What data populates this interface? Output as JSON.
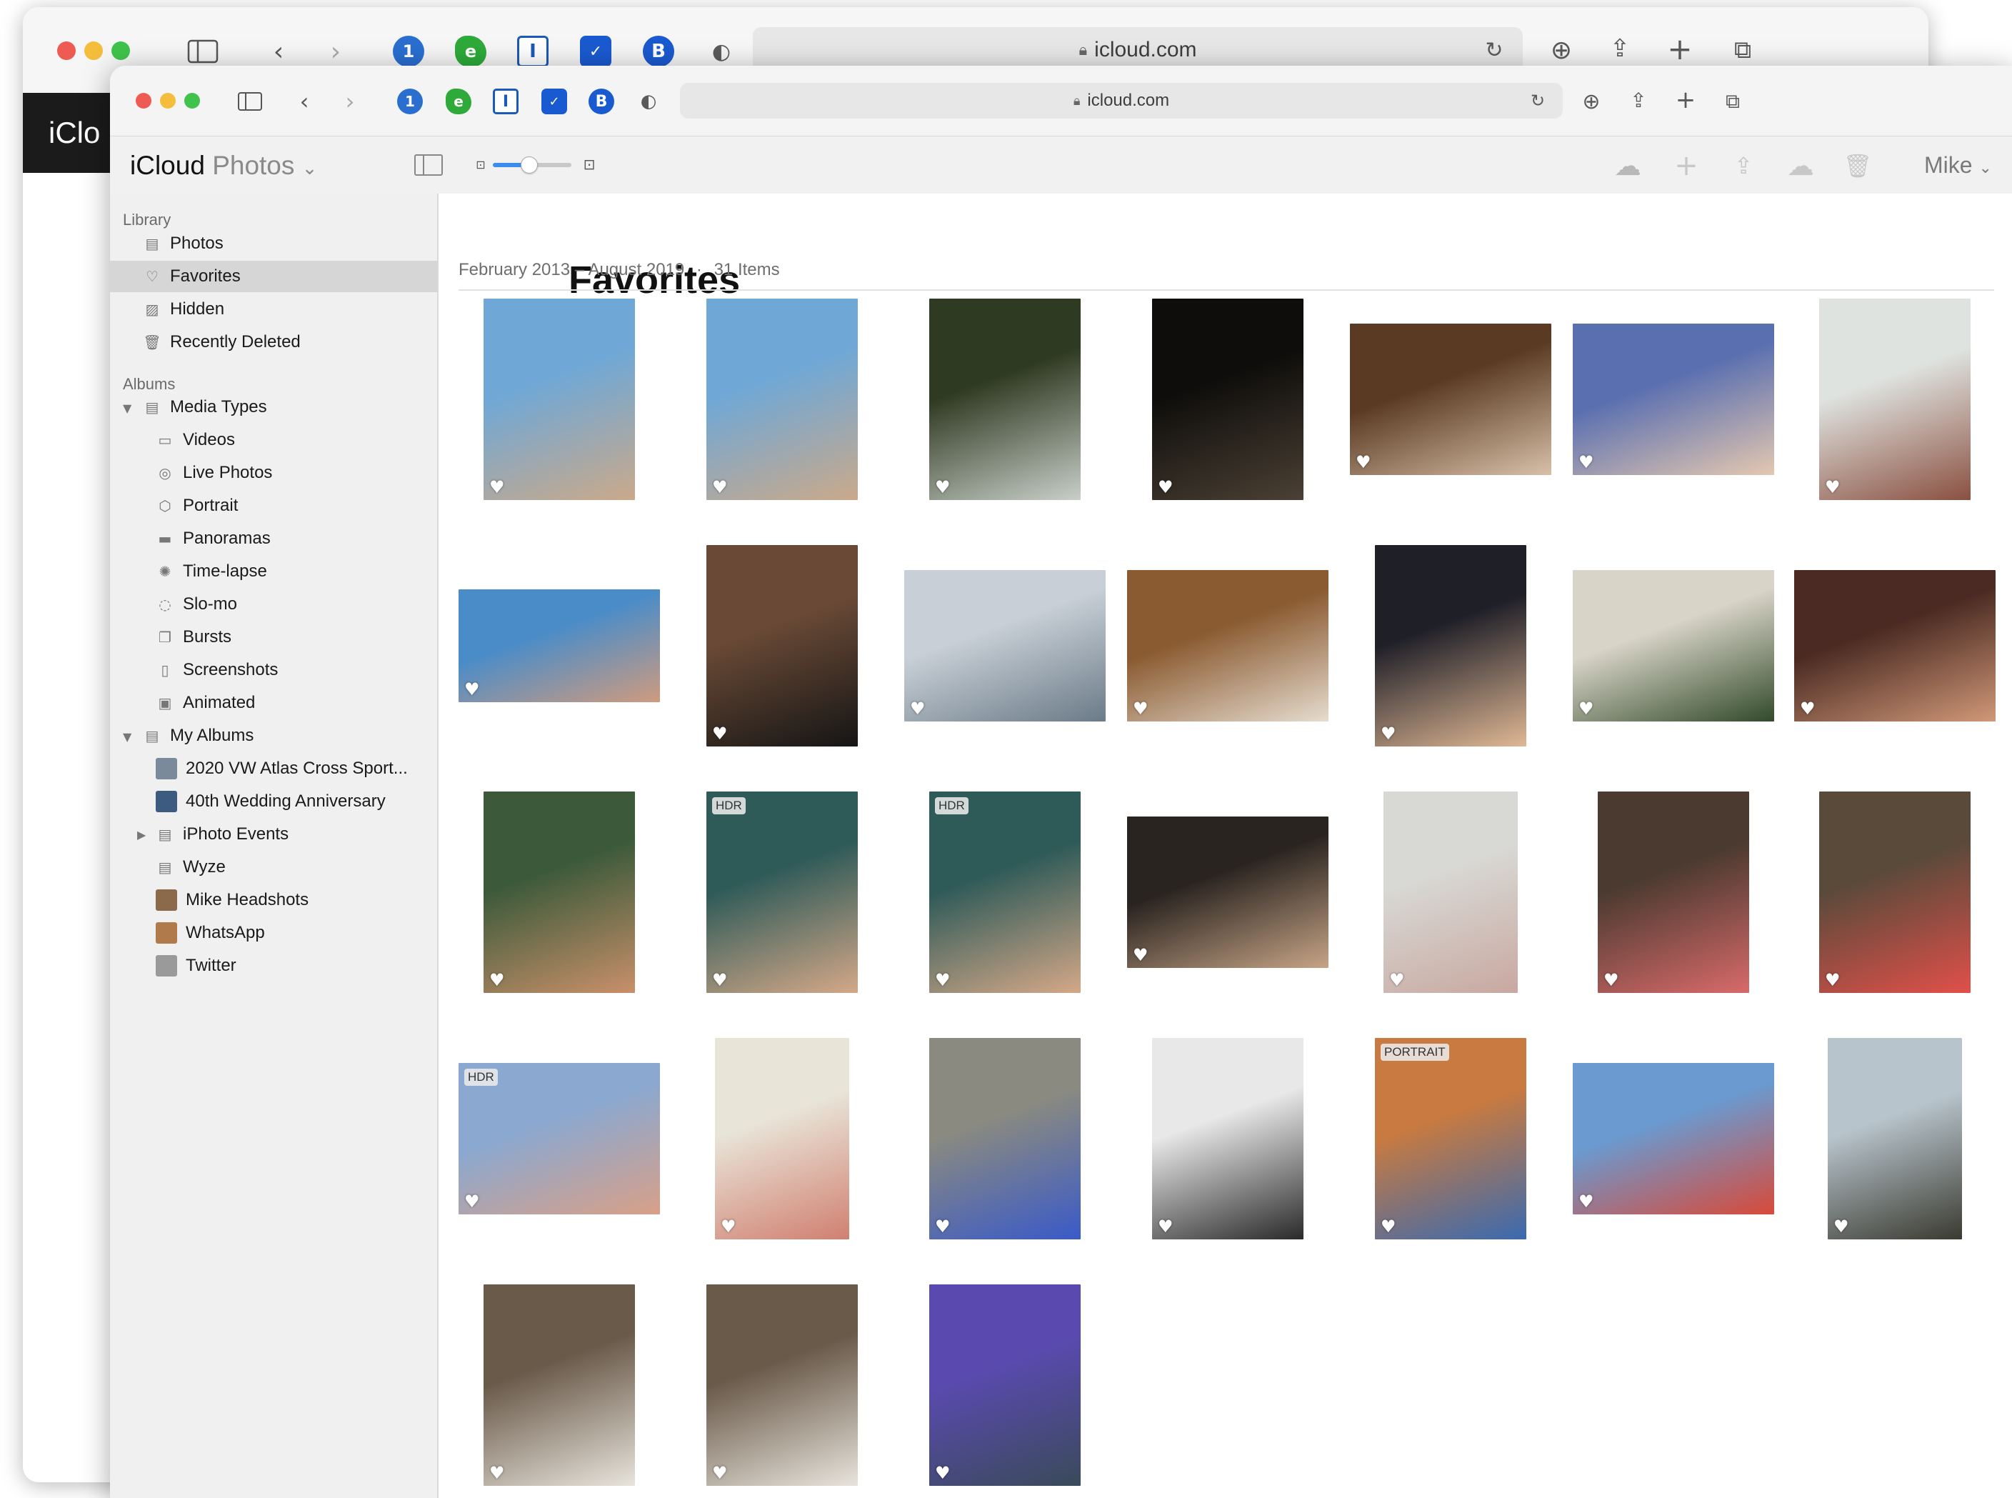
{
  "back_window": {
    "url": "icloud.com",
    "page_peek": "iClo"
  },
  "front_window": {
    "url": "icloud.com"
  },
  "toolbar_icons": [
    "sidebar-toggle-icon",
    "back-icon",
    "forward-icon",
    "onepassword-icon",
    "evernote-icon",
    "instapaper-icon",
    "pocket-icon",
    "bitwarden-icon",
    "privacy-shield-icon",
    "reload-icon",
    "downloads-icon",
    "share-icon",
    "new-tab-icon",
    "tab-overview-icon"
  ],
  "app": {
    "title_brand": "iCloud",
    "title_app": "Photos",
    "title_chevron": "⌄",
    "user_name": "Mike",
    "user_chevron": "⌄",
    "zoom_slider_level": 0.45
  },
  "sidebar": {
    "library_label": "Library",
    "library_items": [
      {
        "label": "Photos",
        "icon": "photos-icon"
      },
      {
        "label": "Favorites",
        "icon": "heart-icon",
        "selected": true
      },
      {
        "label": "Hidden",
        "icon": "hidden-icon"
      },
      {
        "label": "Recently Deleted",
        "icon": "trash-icon"
      }
    ],
    "albums_label": "Albums",
    "media_types_label": "Media Types",
    "media_types": [
      {
        "label": "Videos",
        "icon": "video-icon"
      },
      {
        "label": "Live Photos",
        "icon": "live-photo-icon"
      },
      {
        "label": "Portrait",
        "icon": "portrait-cube-icon"
      },
      {
        "label": "Panoramas",
        "icon": "panorama-icon"
      },
      {
        "label": "Time-lapse",
        "icon": "timelapse-icon"
      },
      {
        "label": "Slo-mo",
        "icon": "slomo-icon"
      },
      {
        "label": "Bursts",
        "icon": "bursts-icon"
      },
      {
        "label": "Screenshots",
        "icon": "screenshot-icon"
      },
      {
        "label": "Animated",
        "icon": "animated-icon"
      }
    ],
    "my_albums_label": "My Albums",
    "my_albums": [
      {
        "label": "2020 VW Atlas Cross Sport...",
        "color": "#7a8a9a"
      },
      {
        "label": "40th Wedding Anniversary",
        "color": "#3d5a80"
      },
      {
        "label": "iPhoto Events",
        "folder": true
      },
      {
        "label": "Wyze",
        "folder": true
      },
      {
        "label": "Mike Headshots",
        "color": "#8a6a4a"
      },
      {
        "label": "WhatsApp",
        "color": "#b07a4a"
      },
      {
        "label": "Twitter",
        "color": "#9a9a9a"
      }
    ]
  },
  "main": {
    "title": "Favorites",
    "date_range": "February 2013 – August 2019",
    "separator": "·",
    "count": "31 Items"
  },
  "photos": [
    {
      "orient": "portrait",
      "c1": "#6fa8d6",
      "c2": "#caa98a"
    },
    {
      "orient": "portrait",
      "c1": "#6fa8d6",
      "c2": "#caa98a"
    },
    {
      "orient": "portrait",
      "c1": "#2f3a22",
      "c2": "#c9cfc9"
    },
    {
      "orient": "portrait",
      "c1": "#0e0d0b",
      "c2": "#4b4034"
    },
    {
      "orient": "landscape",
      "c1": "#5a3a22",
      "c2": "#d8c0a8"
    },
    {
      "orient": "landscape",
      "c1": "#5a6fb0",
      "c2": "#e4c8b0"
    },
    {
      "orient": "portrait",
      "c1": "#dfe3e0",
      "c2": "#8a5040"
    },
    {
      "orient": "wide",
      "c1": "#4a8cc8",
      "c2": "#cf9b7f"
    },
    {
      "orient": "portrait",
      "c1": "#6a4a36",
      "c2": "#151515"
    },
    {
      "orient": "landscape",
      "c1": "#c8cfd6",
      "c2": "#6b7b88"
    },
    {
      "orient": "landscape",
      "c1": "#8a5a30",
      "c2": "#e6dccf"
    },
    {
      "orient": "portrait",
      "c1": "#1f1f28",
      "c2": "#e0b894"
    },
    {
      "orient": "landscape",
      "c1": "#d8d4c8",
      "c2": "#324a2a"
    },
    {
      "orient": "landscape",
      "c1": "#4a2a22",
      "c2": "#d09878"
    },
    {
      "orient": "portrait",
      "c1": "#3c5a3a",
      "c2": "#c8906a"
    },
    {
      "orient": "portrait",
      "c1": "#2e5a58",
      "c2": "#d4a888",
      "badge": "HDR"
    },
    {
      "orient": "portrait",
      "c1": "#2e5a58",
      "c2": "#d4a888",
      "badge": "HDR"
    },
    {
      "orient": "landscape",
      "c1": "#2a2420",
      "c2": "#c6a486"
    },
    {
      "orient": "narrow",
      "c1": "#d8d8d4",
      "c2": "#c8a8a0"
    },
    {
      "orient": "portrait",
      "c1": "#4a3a30",
      "c2": "#d86a6a"
    },
    {
      "orient": "portrait",
      "c1": "#5a4a3a",
      "c2": "#e0504a"
    },
    {
      "orient": "landscape",
      "c1": "#8aa8d0",
      "c2": "#d8a088",
      "badge": "HDR"
    },
    {
      "orient": "narrow",
      "c1": "#e8e4d8",
      "c2": "#d08070"
    },
    {
      "orient": "portrait",
      "c1": "#8a8a80",
      "c2": "#3a5ac8"
    },
    {
      "orient": "portrait",
      "c1": "#e8e8e8",
      "c2": "#2a2a2a"
    },
    {
      "orient": "portrait",
      "c1": "#c87a40",
      "c2": "#3a6ab0",
      "badge": "PORTRAIT"
    },
    {
      "orient": "landscape",
      "c1": "#6a9ad0",
      "c2": "#d84a3a"
    },
    {
      "orient": "narrow",
      "c1": "#b8c4cc",
      "c2": "#3a3a30"
    },
    {
      "orient": "portrait",
      "c1": "#6a5a4a",
      "c2": "#e8e4dc"
    },
    {
      "orient": "portrait",
      "c1": "#6a5a4a",
      "c2": "#e8e4dc"
    },
    {
      "orient": "portrait",
      "c1": "#5a4ab0",
      "c2": "#3a4a5a"
    }
  ],
  "heart_glyph": "♥"
}
